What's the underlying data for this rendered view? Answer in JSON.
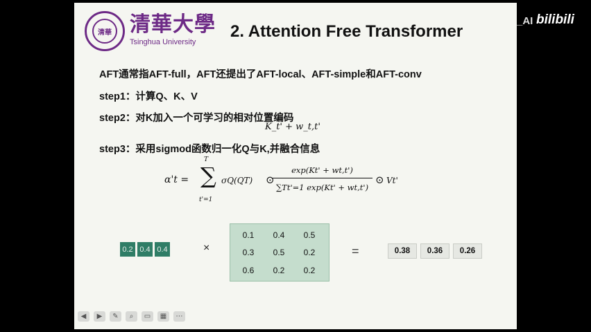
{
  "header": {
    "uni_name": "清華大學",
    "uni_en": "Tsinghua University",
    "seal_text": "清華",
    "title": "2. Attention Free Transformer"
  },
  "body": {
    "line1": "AFT通常指AFT-full，AFT还提出了AFT-local、AFT-simple和AFT-conv",
    "step1": "step1：计算Q、K、V",
    "step2": "step2：对K加入一个可学习的相对位置编码",
    "step2_formula": "K_t' + w_t,t'",
    "step3": "step3：采用sigmod函数归一化Q与K,并融合信息"
  },
  "formula": {
    "lhs": "α't =",
    "sum_symbol": "∑",
    "sum_upper": "T",
    "sum_lower": "t'=1",
    "sigma": "σQ(QT)",
    "odot": "⊙",
    "numerator": "exp(Kt' + wt,t')",
    "denominator": "∑Tt'=1 exp(Kt' + wt,t')",
    "v": "Vt'"
  },
  "example": {
    "vector": [
      "0.2",
      "0.4",
      "0.4"
    ],
    "times": "×",
    "matrix": [
      [
        "0.1",
        "0.4",
        "0.5"
      ],
      [
        "0.3",
        "0.5",
        "0.2"
      ],
      [
        "0.6",
        "0.2",
        "0.2"
      ]
    ],
    "equals": "=",
    "result": [
      "0.38",
      "0.36",
      "0.26"
    ]
  },
  "toolbar": {
    "icons": [
      "back-icon",
      "forward-icon",
      "pen-icon",
      "zoom-icon",
      "video-icon",
      "grid-icon",
      "more-icon"
    ],
    "glyphs": [
      "◀",
      "▶",
      "✎",
      "⌕",
      "▭",
      "▦",
      "⋯"
    ]
  },
  "watermark": {
    "ai": "_AI",
    "bili": "bilibili"
  }
}
